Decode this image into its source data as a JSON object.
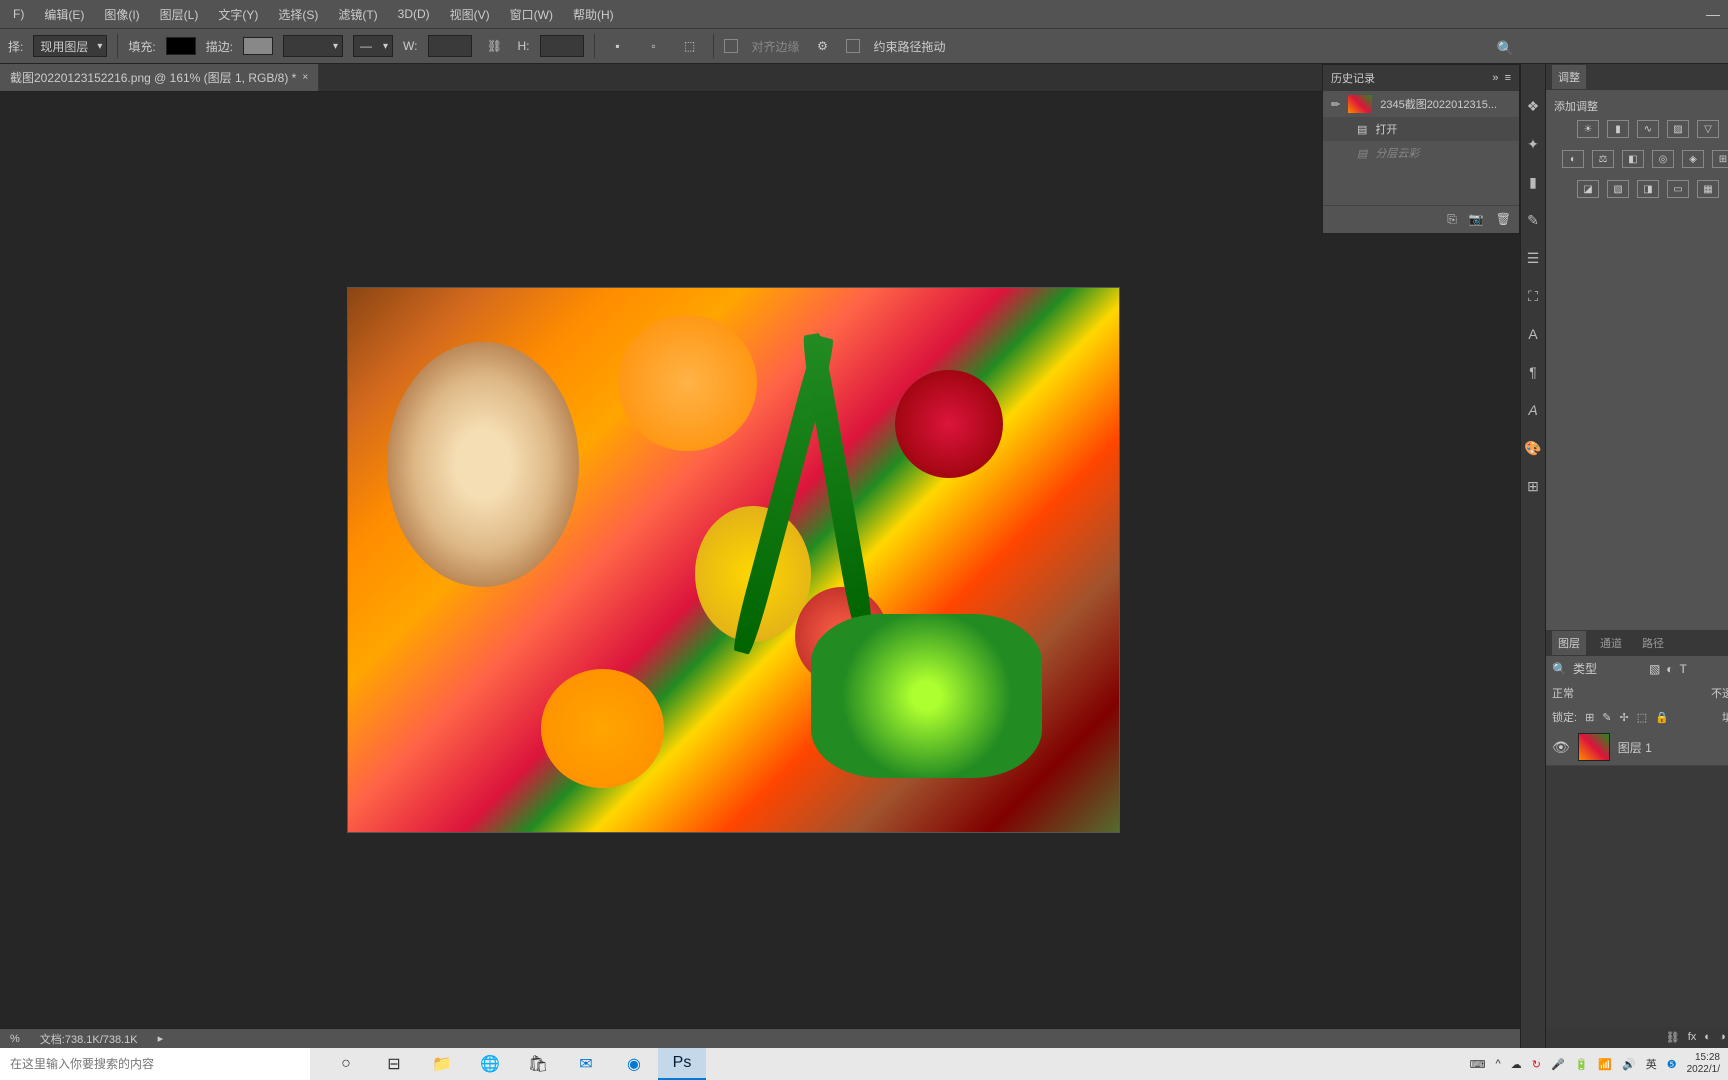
{
  "menu": [
    "编辑(E)",
    "图像(I)",
    "图层(L)",
    "文字(Y)",
    "选择(S)",
    "滤镜(T)",
    "3D(D)",
    "视图(V)",
    "窗口(W)",
    "帮助(H)"
  ],
  "file_menu_partial": "F)",
  "optbar": {
    "select_lbl": "择:",
    "select_val": "现用图层",
    "fill": "填充:",
    "stroke": "描边:",
    "w": "W:",
    "h": "H:",
    "align": "对齐边缘",
    "constrain": "约束路径拖动"
  },
  "tab": {
    "title": "截图20220123152216.png @ 161% (图层 1, RGB/8) *"
  },
  "history": {
    "title": "历史记录",
    "doc": "2345截图2022012315...",
    "open": "打开",
    "clouds": "分层云彩"
  },
  "adjust": {
    "tab": "调整",
    "add": "添加调整"
  },
  "layers": {
    "tab_layers": "图层",
    "tab_channels": "通道",
    "tab_paths": "路径",
    "kind": "类型",
    "mode": "正常",
    "opacity": "不透明",
    "lock": "锁定:",
    "fill": "填充",
    "layer1": "图层 1"
  },
  "status": {
    "zoom": "%",
    "doc": "文档:738.1K/738.1K"
  },
  "taskbar": {
    "search_ph": "在这里输入你要搜索的内容",
    "time": "15:28",
    "date": "2022/1/"
  }
}
